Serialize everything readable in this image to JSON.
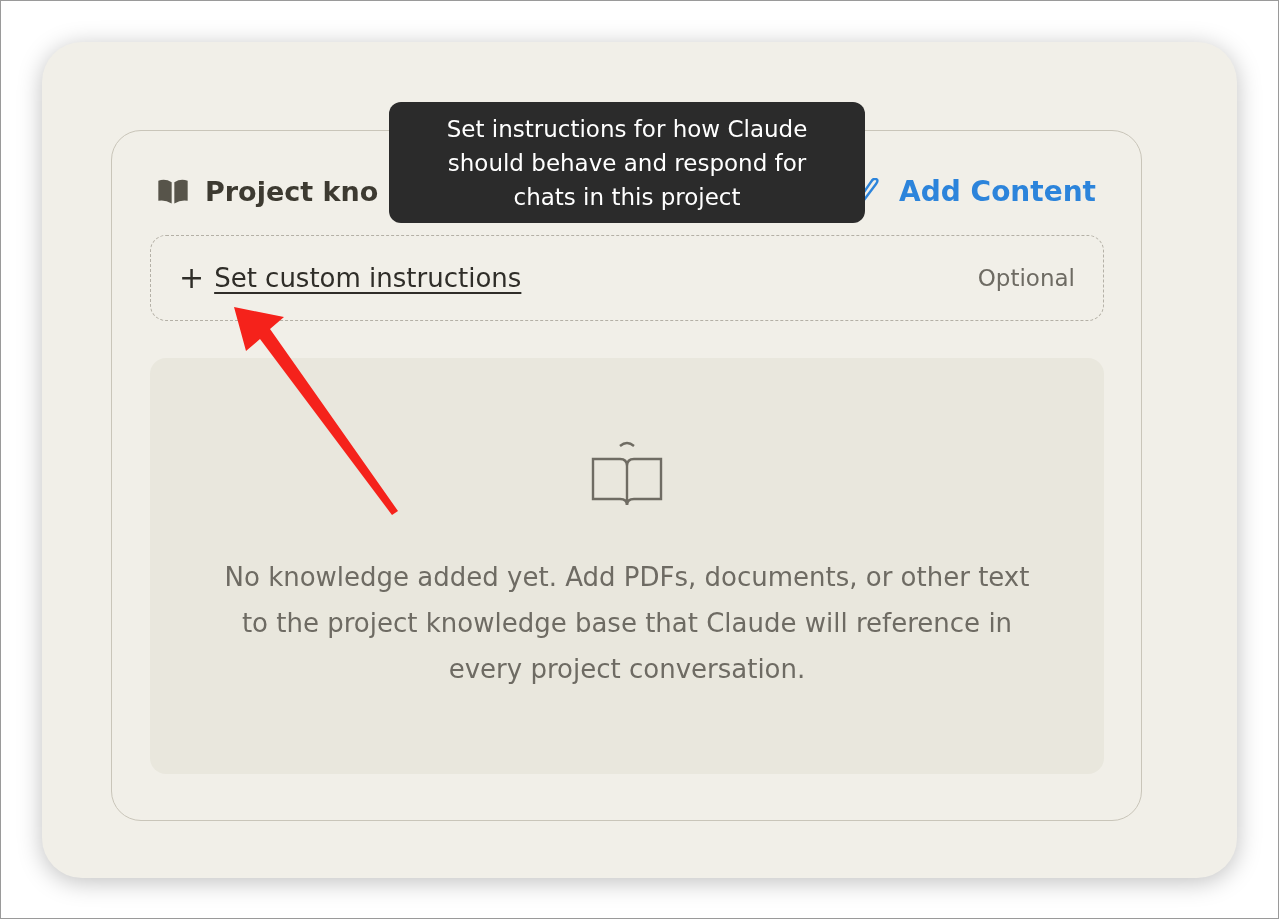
{
  "panel": {
    "title": "Project kno",
    "add_button": "Add Content"
  },
  "tooltip": {
    "text": "Set instructions for how Claude should behave and respond for chats in this project"
  },
  "instructions": {
    "icon": "+",
    "link": "Set custom instructions",
    "badge": "Optional"
  },
  "empty_state": {
    "message": "No knowledge added yet. Add PDFs, documents, or other text to the project knowledge base that Claude will reference in every project conversation."
  }
}
